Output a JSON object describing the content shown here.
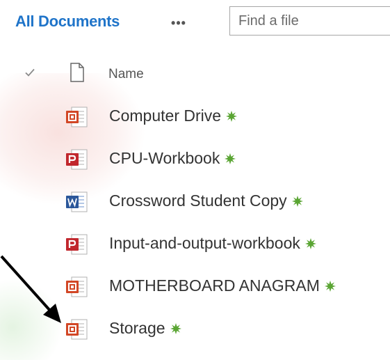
{
  "header": {
    "title": "All Documents",
    "more_label": "•••",
    "search_placeholder": "Find a file"
  },
  "columns": {
    "name_label": "Name"
  },
  "documents": [
    {
      "name": "Computer Drive",
      "icon": "powerpoint-icon",
      "new": true
    },
    {
      "name": "CPU-Workbook",
      "icon": "pdf-icon",
      "new": true
    },
    {
      "name": "Crossword Student Copy",
      "icon": "word-icon",
      "new": true
    },
    {
      "name": "Input-and-output-workbook",
      "icon": "pdf-icon",
      "new": true
    },
    {
      "name": "MOTHERBOARD ANAGRAM",
      "icon": "powerpoint-icon",
      "new": true
    },
    {
      "name": "Storage",
      "icon": "powerpoint-icon",
      "new": true
    }
  ],
  "colors": {
    "title": "#1f74c9",
    "new_badge": "#5aa533",
    "powerpoint": "#d24726",
    "pdf": "#c1272d",
    "word": "#2b579a"
  }
}
